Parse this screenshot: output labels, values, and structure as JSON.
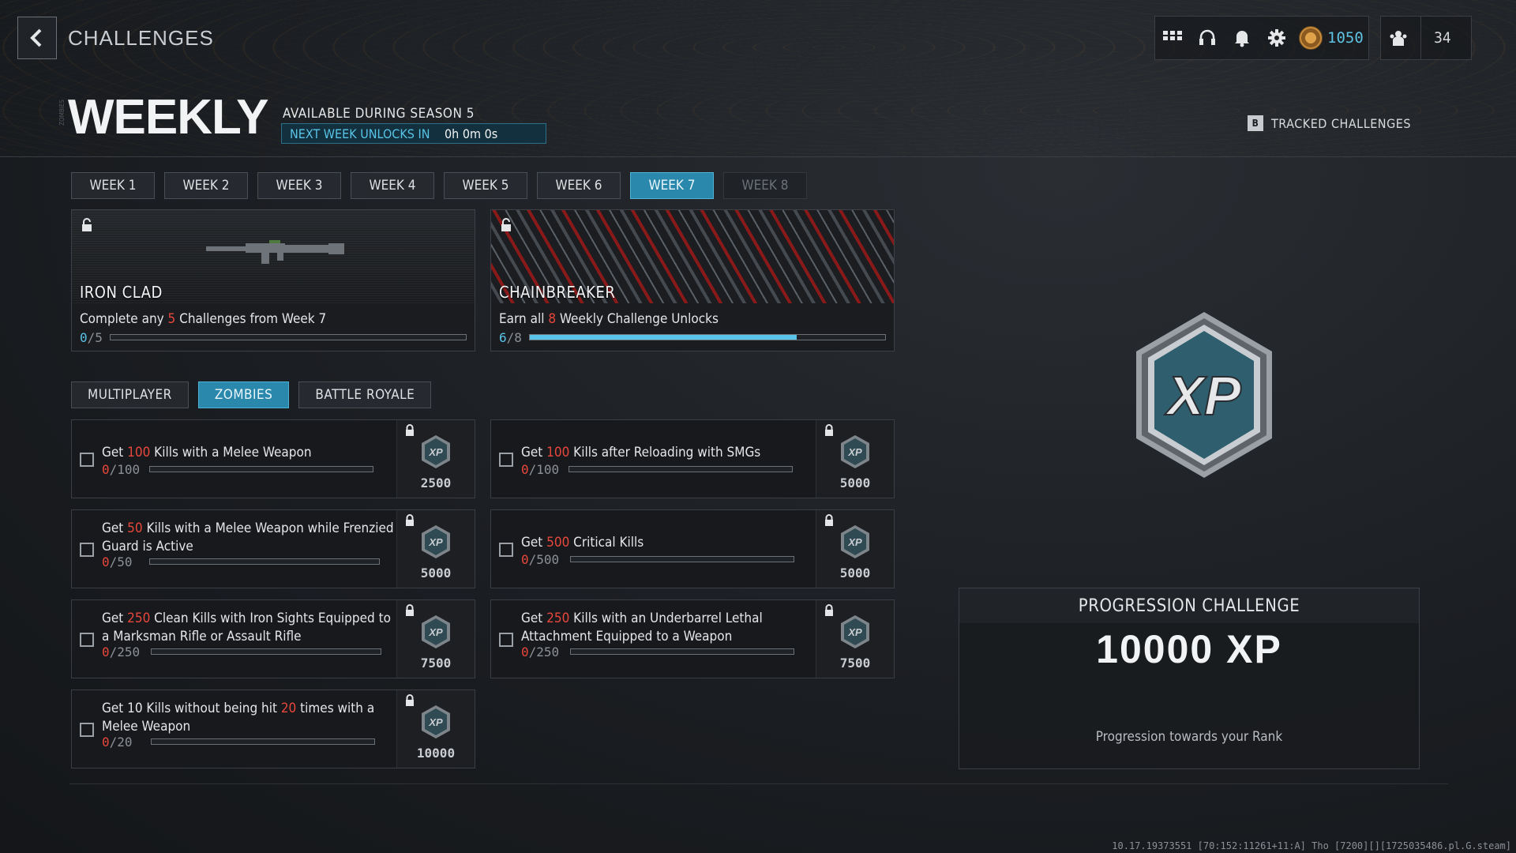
{
  "header": {
    "title": "CHALLENGES",
    "cod_points": "1050",
    "friends_count": "34",
    "tracked_key": "B",
    "tracked_label": "TRACKED CHALLENGES",
    "side_tag": "ZOMBIES"
  },
  "weekly": {
    "title": "WEEKLY",
    "season_text": "AVAILABLE DURING SEASON 5",
    "unlock_label": "NEXT WEEK UNLOCKS IN",
    "unlock_time": "0h 0m 0s"
  },
  "week_tabs": [
    {
      "label": "WEEK 1",
      "state": "normal"
    },
    {
      "label": "WEEK 2",
      "state": "normal"
    },
    {
      "label": "WEEK 3",
      "state": "normal"
    },
    {
      "label": "WEEK 4",
      "state": "normal"
    },
    {
      "label": "WEEK 5",
      "state": "normal"
    },
    {
      "label": "WEEK 6",
      "state": "normal"
    },
    {
      "label": "WEEK 7",
      "state": "active"
    },
    {
      "label": "WEEK 8",
      "state": "locked"
    }
  ],
  "rewards": [
    {
      "name": "IRON CLAD",
      "desc_pre": "Complete any ",
      "desc_hl": "5",
      "desc_post": " Challenges from Week 7",
      "current": "0",
      "total": "/5",
      "progress": 0.0
    },
    {
      "name": "CHAINBREAKER",
      "desc_pre": "Earn all ",
      "desc_hl": "8",
      "desc_post": " Weekly Challenge Unlocks",
      "current": "6",
      "total": "/8",
      "progress": 0.75
    }
  ],
  "mode_tabs": [
    {
      "label": "MULTIPLAYER",
      "active": false
    },
    {
      "label": "ZOMBIES",
      "active": true
    },
    {
      "label": "BATTLE ROYALE",
      "active": false
    }
  ],
  "challenges": [
    {
      "pre": "Get ",
      "hl": "100",
      "post": " Kills with a Melee Weapon",
      "current": "0",
      "total": "/100",
      "xp": "2500",
      "progress": 0
    },
    {
      "pre": "Get ",
      "hl": "100",
      "post": " Kills after Reloading with SMGs",
      "current": "0",
      "total": "/100",
      "xp": "5000",
      "progress": 0
    },
    {
      "pre": "Get ",
      "hl": "50",
      "post": " Kills with a Melee Weapon while Frenzied Guard is Active",
      "current": "0",
      "total": "/50",
      "xp": "5000",
      "progress": 0
    },
    {
      "pre": "Get ",
      "hl": "500",
      "post": " Critical Kills",
      "current": "0",
      "total": "/500",
      "xp": "5000",
      "progress": 0
    },
    {
      "pre": "Get ",
      "hl": "250",
      "post": " Clean Kills with Iron Sights Equipped to a Marksman Rifle or Assault Rifle",
      "current": "0",
      "total": "/250",
      "xp": "7500",
      "progress": 0
    },
    {
      "pre": "Get ",
      "hl": "250",
      "post": " Kills with an Underbarrel Lethal Attachment Equipped to a Weapon",
      "current": "0",
      "total": "/250",
      "xp": "7500",
      "progress": 0
    },
    {
      "pre": "Get 10 Kills without being hit ",
      "hl": "20",
      "post": " times with a Melee Weapon",
      "current": "0",
      "total": "/20",
      "xp": "10000",
      "progress": 0
    }
  ],
  "progression": {
    "title": "PROGRESSION CHALLENGE",
    "xp": "10000 XP",
    "sub": "Progression towards your Rank",
    "xp_logo": "XP"
  },
  "footer": {
    "build": "10.17.19373551 [70:152:11261+11:A] Tho [7200][][1725035486.pl.G.steam]"
  },
  "colors": {
    "accent": "#2b88ad",
    "accent_text": "#59c4e8",
    "highlight": "#e8473c"
  }
}
